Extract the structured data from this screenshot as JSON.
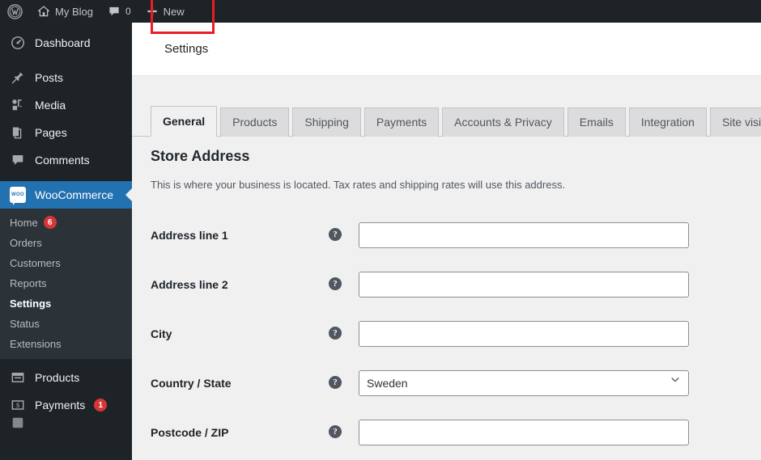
{
  "adminbar": {
    "logo_icon": "wordpress-logo-icon",
    "site_icon": "home-icon",
    "site_name": "My Blog",
    "comments_icon": "comment-bubble-icon",
    "comments_count": "0",
    "new_icon": "plus-icon",
    "new_label": "New"
  },
  "sidebar": {
    "items": [
      {
        "label": "Dashboard",
        "icon": "dashboard-icon",
        "key": "dashboard"
      },
      {
        "label": "Posts",
        "icon": "pin-icon",
        "key": "posts"
      },
      {
        "label": "Media",
        "icon": "media-icon",
        "key": "media"
      },
      {
        "label": "Pages",
        "icon": "pages-icon",
        "key": "pages"
      },
      {
        "label": "Comments",
        "icon": "comment-bubble-icon",
        "key": "comments"
      },
      {
        "label": "WooCommerce",
        "icon": "woocommerce-icon",
        "key": "woocommerce",
        "current": true
      },
      {
        "label": "Products",
        "icon": "products-box-icon",
        "key": "products"
      },
      {
        "label": "Payments",
        "icon": "payments-dollar-icon",
        "key": "payments",
        "badge": "1"
      }
    ],
    "submenu": [
      {
        "label": "Home",
        "badge": "6",
        "active": false
      },
      {
        "label": "Orders",
        "active": false
      },
      {
        "label": "Customers",
        "active": false
      },
      {
        "label": "Reports",
        "active": false
      },
      {
        "label": "Settings",
        "active": true
      },
      {
        "label": "Status",
        "active": false
      },
      {
        "label": "Extensions",
        "active": false
      }
    ]
  },
  "page": {
    "title": "Settings"
  },
  "tabs": [
    {
      "label": "General",
      "active": true
    },
    {
      "label": "Products",
      "active": false
    },
    {
      "label": "Shipping",
      "active": false
    },
    {
      "label": "Payments",
      "active": false
    },
    {
      "label": "Accounts & Privacy",
      "active": false
    },
    {
      "label": "Emails",
      "active": false
    },
    {
      "label": "Integration",
      "active": false
    },
    {
      "label": "Site visibility",
      "active": false
    }
  ],
  "section": {
    "title": "Store Address",
    "description": "This is where your business is located. Tax rates and shipping rates will use this address."
  },
  "fields": [
    {
      "label": "Address line 1",
      "type": "text",
      "value": "",
      "placeholder": "",
      "help": "?"
    },
    {
      "label": "Address line 2",
      "type": "text",
      "value": "",
      "placeholder": "",
      "help": "?"
    },
    {
      "label": "City",
      "type": "text",
      "value": "",
      "placeholder": "",
      "help": "?"
    },
    {
      "label": "Country / State",
      "type": "select",
      "value": "Sweden",
      "help": "?"
    },
    {
      "label": "Postcode / ZIP",
      "type": "text",
      "value": "",
      "placeholder": "",
      "help": "?"
    }
  ],
  "annotation": {
    "highlight_color": "#ec1c24",
    "highlighted_element": "General"
  },
  "colors": {
    "admin_bar": "#1d2327",
    "sidebar": "#1d2327",
    "submenu": "#2c3338",
    "current_menu": "#2271b1",
    "content_bg": "#f0f0f1",
    "badge": "#d63638"
  }
}
